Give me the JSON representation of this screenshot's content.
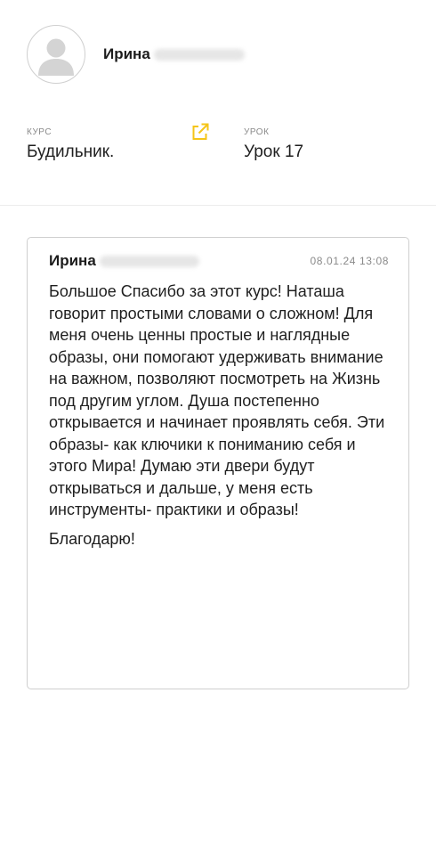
{
  "user": {
    "first_name": "Ирина",
    "avatar_icon": "user-silhouette-icon"
  },
  "meta": {
    "course_label": "КУРС",
    "course_value": "Будильник.",
    "lesson_label": "УРОК",
    "lesson_value": "Урок 17",
    "link_icon": "external-link-icon",
    "accent_color": "#f5c518"
  },
  "comment": {
    "author_first_name": "Ирина",
    "date": "08.01.24 13:08",
    "text": "Большое Спасибо за этот курс! Наташа говорит простыми словами о сложном! Для меня очень ценны простые и наглядные образы, они помогают удерживать внимание на важном, позволяют посмотреть на Жизнь под другим углом. Душа постепенно открывается и начинает проявлять себя. Эти образы- как ключики к пониманию себя и этого Мира! Думаю эти двери будут открываться и дальше, у меня есть инструменты- практики и образы!",
    "closing": "Благодарю!"
  }
}
